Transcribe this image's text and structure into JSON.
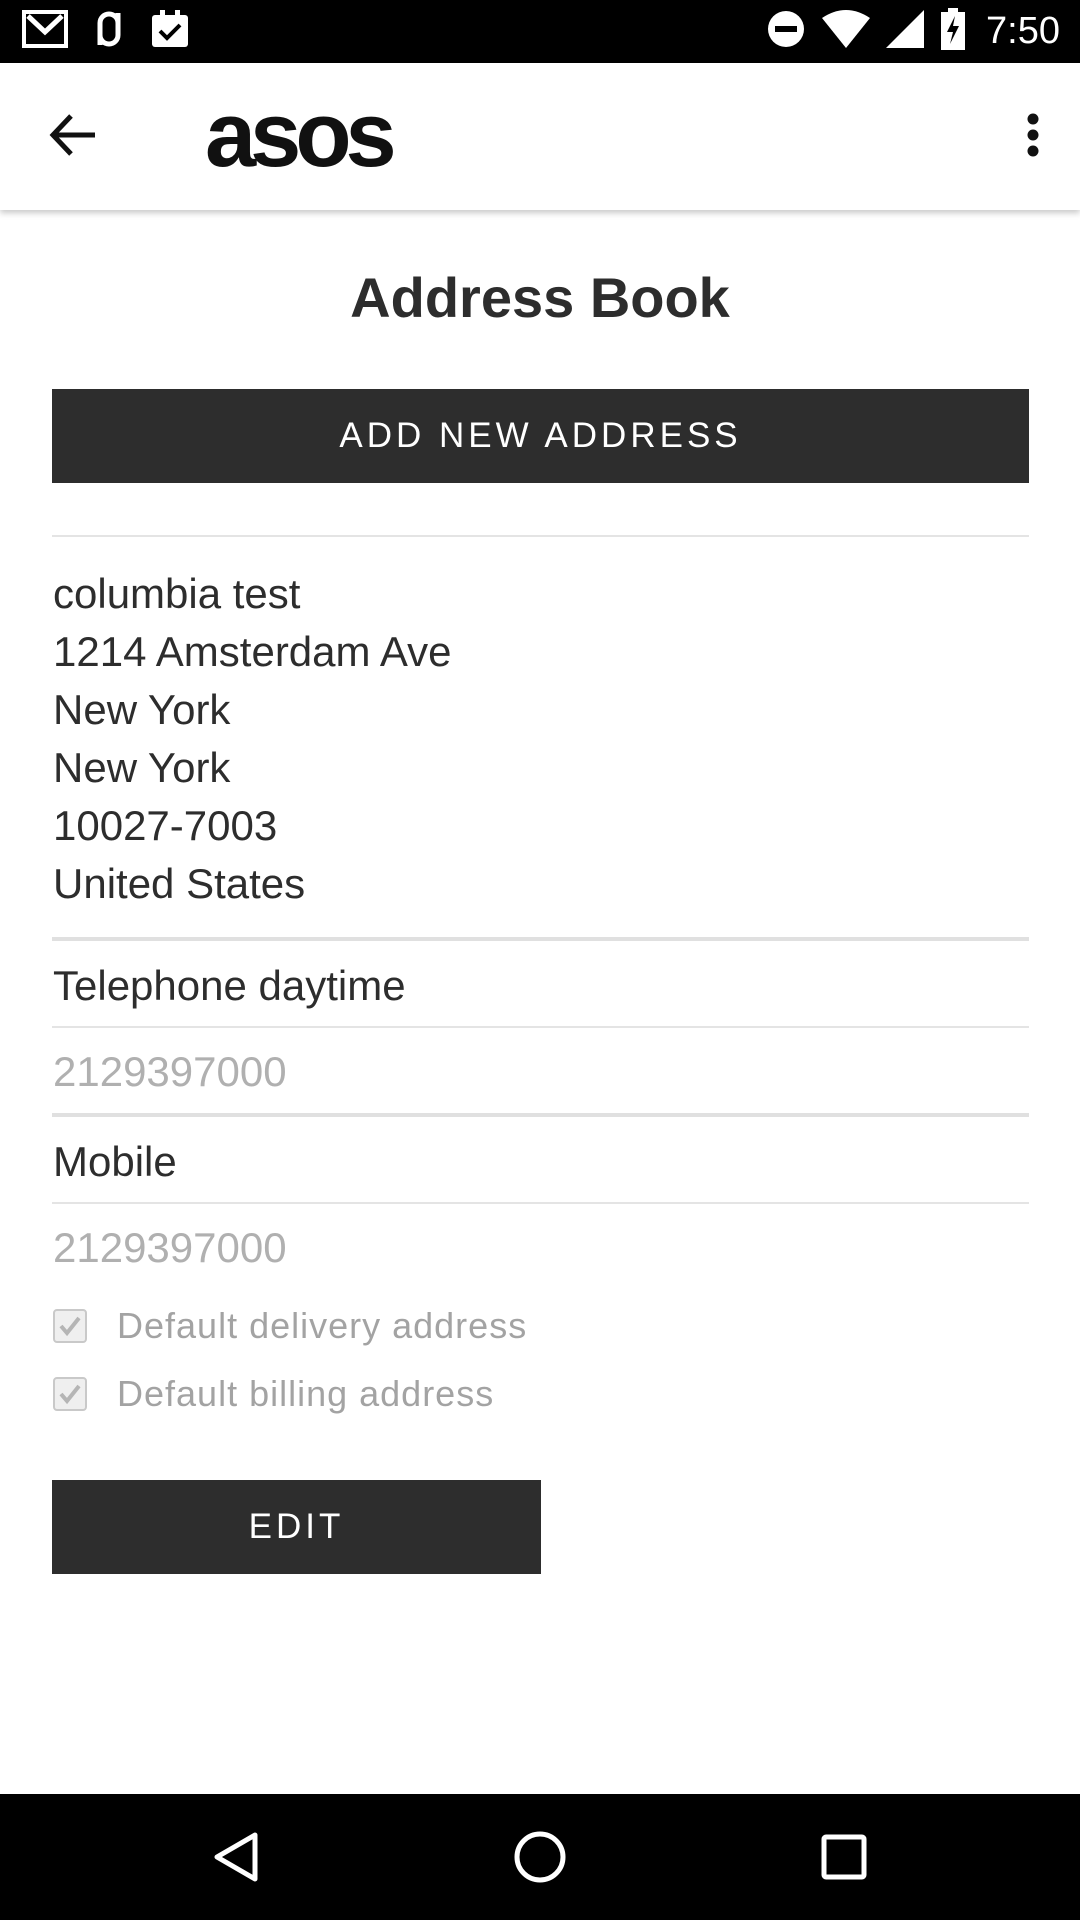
{
  "status_bar": {
    "time": "7:50",
    "icons_left": [
      "gmail-icon",
      "link-icon",
      "calendar-check-icon"
    ],
    "icons_right": [
      "do-not-disturb-icon",
      "wifi-icon",
      "signal-icon",
      "battery-charging-icon"
    ]
  },
  "app_bar": {
    "logo": "asos",
    "back_icon": "arrow-back-icon",
    "more_icon": "more-vert-icon"
  },
  "page": {
    "title": "Address Book",
    "add_button_label": "ADD NEW ADDRESS"
  },
  "address": {
    "lines": [
      "columbia test",
      "1214 Amsterdam Ave",
      "New York",
      "New York",
      "10027-7003",
      "United States"
    ]
  },
  "phones": {
    "daytime_label": "Telephone daytime",
    "daytime_value": "2129397000",
    "mobile_label": "Mobile",
    "mobile_value": "2129397000"
  },
  "defaults": {
    "delivery_label": "Default delivery address",
    "delivery_checked": true,
    "billing_label": "Default billing address",
    "billing_checked": true
  },
  "edit_button_label": "EDIT",
  "nav_bar": {
    "icons": [
      "back-triangle-icon",
      "home-circle-icon",
      "recents-square-icon"
    ]
  },
  "colors": {
    "button_bg": "#2d2d2d",
    "text": "#2d2d2d",
    "muted_text": "#b0b0b0"
  }
}
